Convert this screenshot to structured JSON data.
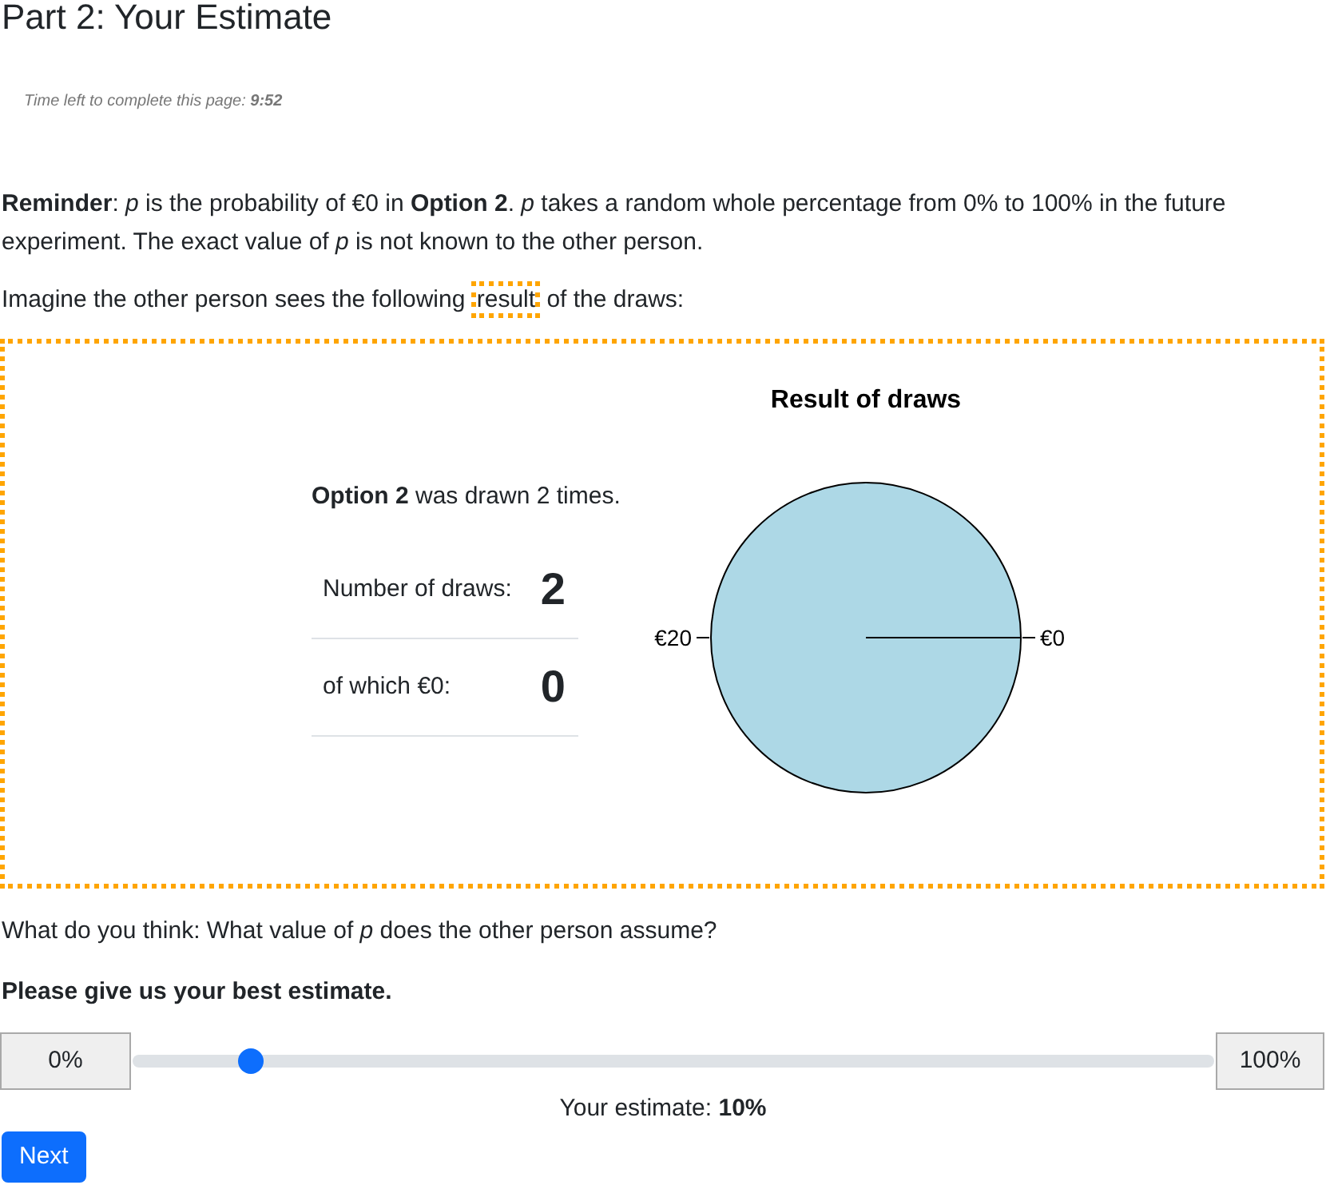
{
  "title": "Part 2: Your Estimate",
  "timer": "Time left to complete this page: **9:52**",
  "reminder": "**Reminder**: *p* is the probability of €0 in **Option 2**. *p* takes a random whole percentage from 0% to 100% in the future experiment. The exact value of *p* is not known to the other person.",
  "intro": {
    "before": "Imagine the other person sees the following",
    "highlight": "result",
    "after": "of the draws:"
  },
  "draws_panel": {
    "summary": "**Option 2** was drawn 2 times.",
    "rows": [
      {
        "label": "Number of draws:",
        "value": "2"
      },
      {
        "label": "of which €0:",
        "value": "0"
      }
    ],
    "chart_data": {
      "type": "pie",
      "title": "Result of draws",
      "categories": [
        "€0",
        "€20"
      ],
      "values": [
        0,
        100
      ]
    }
  },
  "question": "What do you think: What value of *p* does the other person assume?",
  "prompt": "Please give us your best estimate.",
  "slider": {
    "min_label": "0%",
    "max_label": "100%",
    "level": 0.1
  },
  "estimate": "Your estimate: **10%**",
  "buttons": [
    "Next"
  ]
}
